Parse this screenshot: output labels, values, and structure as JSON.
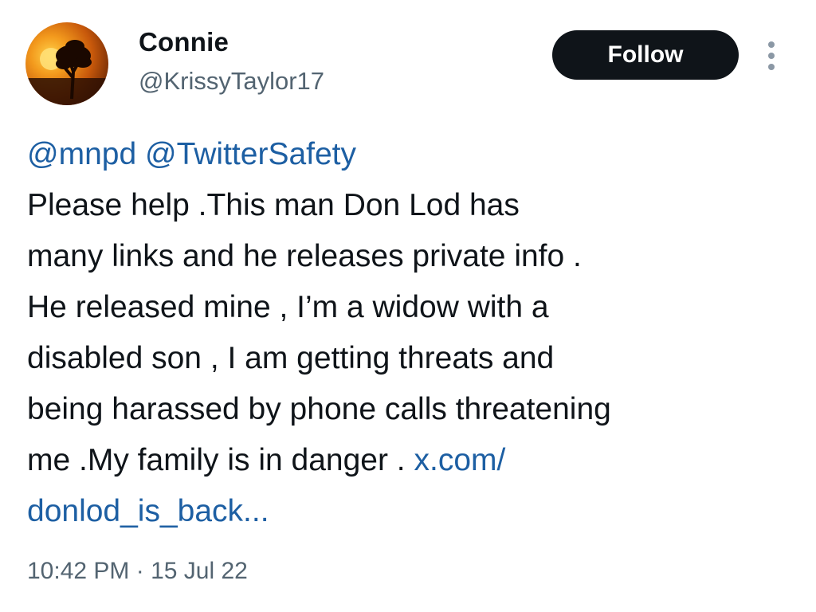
{
  "author": {
    "display_name": "Connie",
    "handle": "@KrissyTaylor17",
    "avatar_icon": "sunset-tree-avatar"
  },
  "actions": {
    "follow_label": "Follow",
    "more_icon": "more-vertical-icon"
  },
  "tweet": {
    "mention_1": "@mnpd",
    "mention_2": "@TwitterSafety",
    "line_2": "Please help .This man Don Lod has",
    "line_3": "many links and he releases private info .",
    "line_4": "He released mine , I’m a widow with a",
    "line_5": "disabled son , I am getting threats and",
    "line_6": "being harassed by phone calls threatening",
    "line_7_text": "me .My family is in danger .",
    "link_part_1": "x.com/",
    "link_part_2": "donlod_is_back..."
  },
  "meta": {
    "timestamp": "10:42 PM · 15 Jul 22"
  },
  "colors": {
    "link": "#1d5fa3",
    "follow_bg": "#0f1419",
    "secondary_text": "#536471"
  }
}
